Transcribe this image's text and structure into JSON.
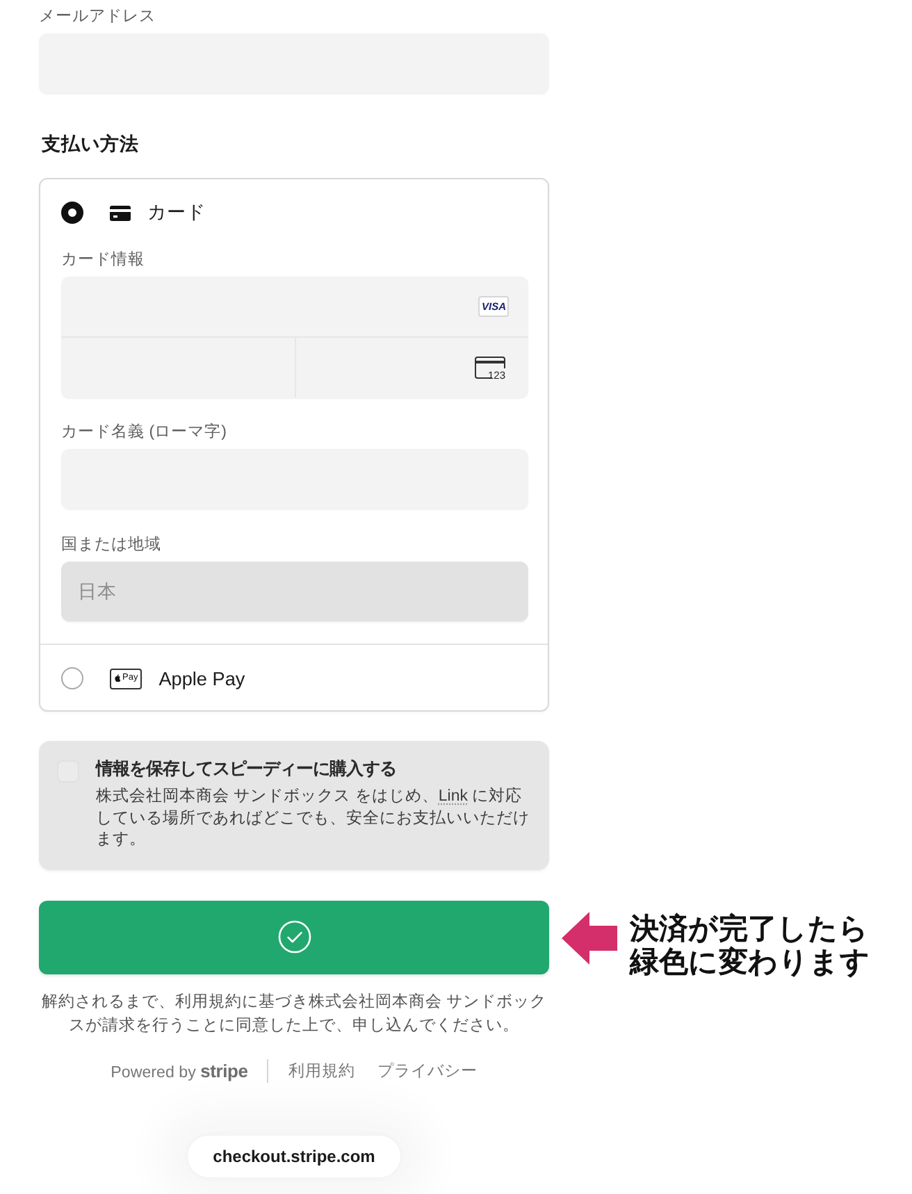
{
  "email": {
    "label": "メールアドレス"
  },
  "payment": {
    "heading": "支払い方法",
    "methods": [
      {
        "kind": "card",
        "label": "カード",
        "selected": true,
        "card_info": {
          "label": "カード情報",
          "brand": "VISA",
          "cvc_hint": "123"
        },
        "cardholder": {
          "label": "カード名義 (ローマ字)"
        },
        "country": {
          "label": "国または地域",
          "value": "日本",
          "disabled": true
        }
      },
      {
        "kind": "apple_pay",
        "label": "Apple Pay",
        "mark": "Pay",
        "selected": false
      }
    ]
  },
  "save_info": {
    "checked": false,
    "disabled": true,
    "title": "情報を保存してスピーディーに購入する",
    "description": [
      {
        "kind": "text",
        "text": "株式会社岡本商会 サンドボックス をはじめ、"
      },
      {
        "kind": "link",
        "text": "Link"
      },
      {
        "kind": "text",
        "text": " に対応している場所であればどこでも、安全にお支払いいただけます。"
      }
    ]
  },
  "pay_button": {
    "complete": true
  },
  "annotation": {
    "text": "決済が完了したら緑色に変わります"
  },
  "terms": "解約されるまで、利用規約に基づき株式会社岡本商会 サンドボックスが請求を行うことに同意した上で、申し込んでください。",
  "footer": {
    "powered_by": "Powered by **stripe**",
    "links": [
      "利用規約",
      "プライバシー"
    ]
  },
  "url_bar": {
    "text": "checkout.stripe.com"
  }
}
